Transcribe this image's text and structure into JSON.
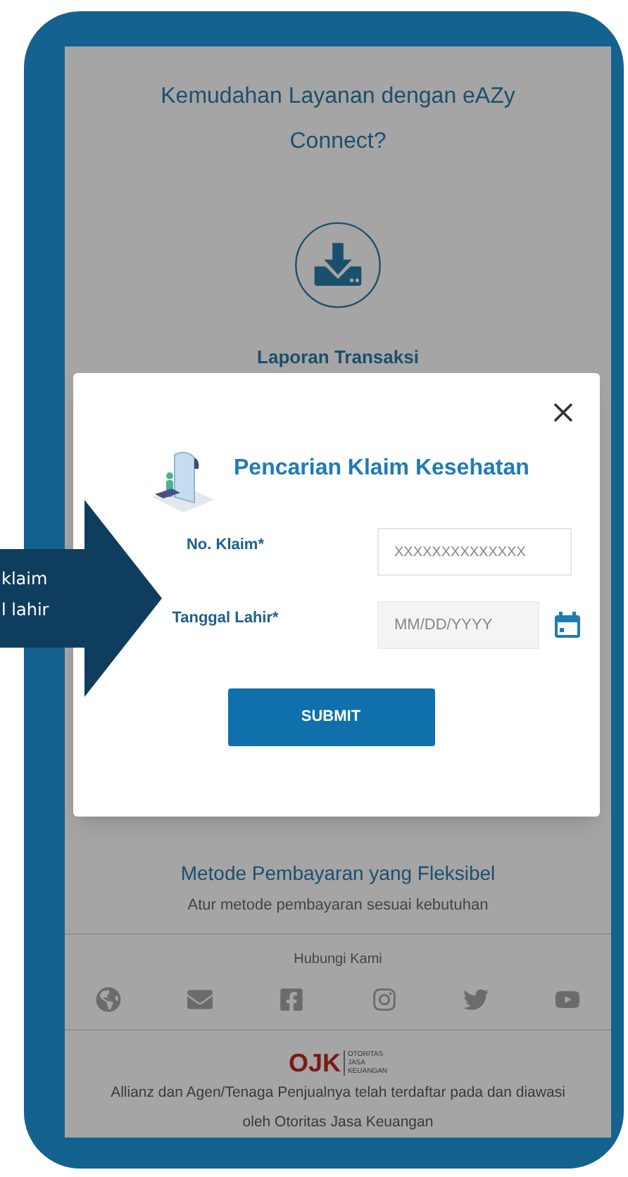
{
  "page": {
    "title": "Kemudahan Layanan dengan eAZy Connect?",
    "feature": {
      "label": "Laporan Transaksi"
    }
  },
  "dialog": {
    "title": "Pencarian Klaim Kesehatan",
    "fields": [
      {
        "kind": "text",
        "label": "No. Klaim*",
        "placeholder": "XXXXXXXXXXXXXX"
      },
      {
        "kind": "date",
        "label": "Tanggal Lahir*",
        "placeholder": "MM/DD/YYYY"
      }
    ],
    "submit": "SUBMIT"
  },
  "section": {
    "title": "Metode Pembayaran yang Fleksibel",
    "subtitle": "Atur metode pembayaran sesuai kebutuhan"
  },
  "contact": {
    "title": "Hubungi Kami"
  },
  "footer": {
    "logo": "OJK",
    "logo_caption": [
      "OTORITAS",
      "JASA",
      "KEUANGAN"
    ],
    "text": "Allianz dan Agen/Tenaga Penjualnya telah terdaftar pada dan diawasi oleh Otoritas Jasa Keuangan"
  },
  "callout": {
    "lines": [
      "klaim",
      "l lahir"
    ]
  }
}
